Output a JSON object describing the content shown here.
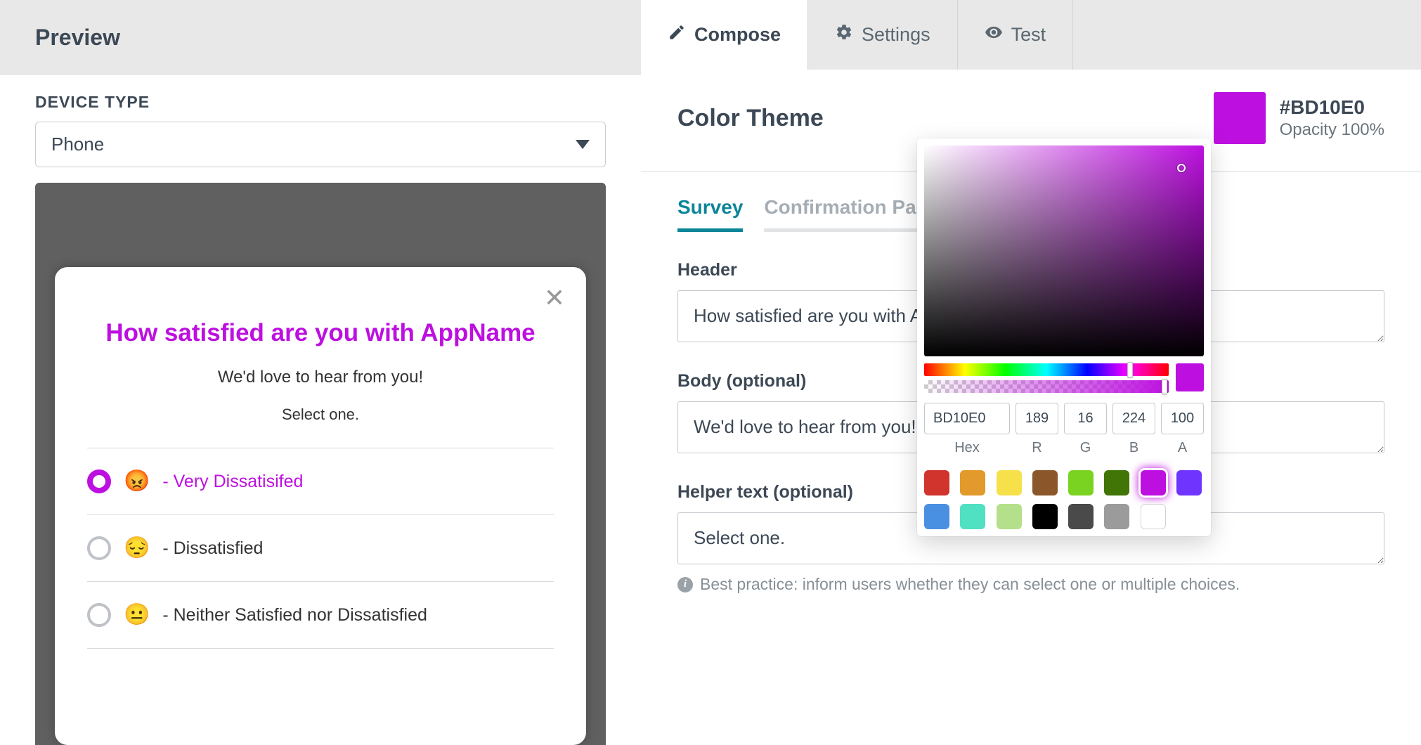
{
  "left": {
    "title": "Preview",
    "device_type_label": "DEVICE TYPE",
    "device_type_value": "Phone"
  },
  "survey_preview": {
    "header": "How satisfied are you with AppName",
    "body": "We'd love to hear from you!",
    "helper": "Select one.",
    "options": [
      {
        "emoji": "😡",
        "label": "- Very Dissatisifed",
        "selected": true
      },
      {
        "emoji": "😔",
        "label": "- Dissatisfied",
        "selected": false
      },
      {
        "emoji": "😐",
        "label": "- Neither Satisfied nor Dissatisfied",
        "selected": false
      }
    ]
  },
  "tabs": {
    "compose": "Compose",
    "settings": "Settings",
    "test": "Test"
  },
  "theme": {
    "title": "Color Theme",
    "hex": "#BD10E0",
    "opacity": "Opacity 100%"
  },
  "subtabs": {
    "survey": "Survey",
    "confirmation": "Confirmation Page"
  },
  "form": {
    "header_label": "Header",
    "header_value": "How satisfied are you with AppName",
    "body_label": "Body (optional)",
    "body_value": "We'd love to hear from you!",
    "helper_label": "Helper text (optional)",
    "helper_value": "Select one.",
    "helper_hint": "Best practice: inform users whether they can select one or multiple choices."
  },
  "color_picker": {
    "hex": "BD10E0",
    "r": "189",
    "g": "16",
    "b": "224",
    "a": "100",
    "labels": {
      "hex": "Hex",
      "r": "R",
      "g": "G",
      "b": "B",
      "a": "A"
    },
    "swatches": [
      "#d0342c",
      "#e19a2b",
      "#f6e14b",
      "#8b572a",
      "#7bd321",
      "#417505",
      "#bd10e0",
      "#6f35ff",
      "#4a90e2",
      "#50e0c2",
      "#b5e08b",
      "#000000",
      "#4a4a4a",
      "#9b9b9b",
      "#ffffff"
    ],
    "active_swatch_index": 6,
    "hue_thumb_pct": 83,
    "alpha_thumb_pct": 97
  }
}
